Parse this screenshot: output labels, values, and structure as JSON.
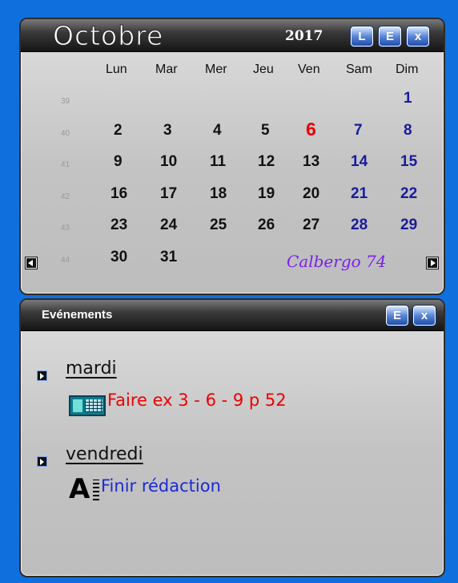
{
  "calendar": {
    "month": "Octobre",
    "year": "2017",
    "buttons": {
      "l": "L",
      "e": "E",
      "close": "x"
    },
    "weekdays": [
      "Lun",
      "Mar",
      "Mer",
      "Jeu",
      "Ven",
      "Sam",
      "Dim"
    ],
    "weeks": [
      {
        "num": "39",
        "days": [
          "",
          "",
          "",
          "",
          "",
          "",
          "1"
        ]
      },
      {
        "num": "40",
        "days": [
          "2",
          "3",
          "4",
          "5",
          "6",
          "7",
          "8"
        ]
      },
      {
        "num": "41",
        "days": [
          "9",
          "10",
          "11",
          "12",
          "13",
          "14",
          "15"
        ]
      },
      {
        "num": "42",
        "days": [
          "16",
          "17",
          "18",
          "19",
          "20",
          "21",
          "22"
        ]
      },
      {
        "num": "43",
        "days": [
          "23",
          "24",
          "25",
          "26",
          "27",
          "28",
          "29"
        ]
      },
      {
        "num": "44",
        "days": [
          "30",
          "31",
          "",
          "",
          "",
          "",
          ""
        ]
      }
    ],
    "today": "6",
    "signature": "Calbergo 74",
    "colors": {
      "weekend": "#1a1a9c",
      "today": "#ee0000",
      "signature": "#7a1ef0"
    }
  },
  "events": {
    "title": "Evénements",
    "buttons": {
      "e": "E",
      "close": "x"
    },
    "items": [
      {
        "day": "mardi",
        "icon": "calculator-icon",
        "text": "Faire ex 3 - 6 - 9 p 52",
        "color": "#ee0000"
      },
      {
        "day": "vendredi",
        "icon": "font-icon",
        "text": "Finir rédaction",
        "color": "#1a2ad8"
      }
    ]
  }
}
